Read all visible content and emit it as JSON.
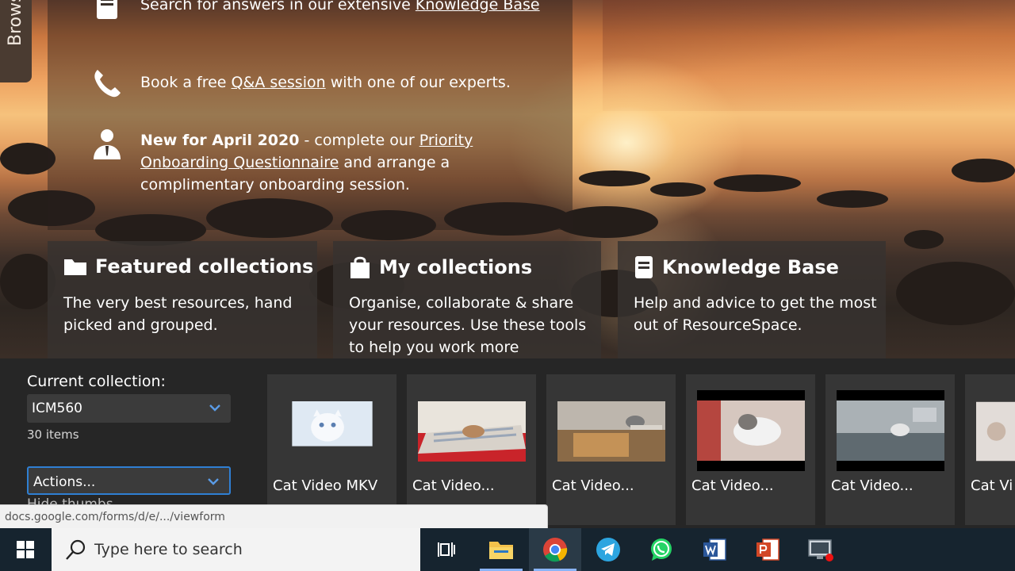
{
  "browse_tab": {
    "label": "Browse"
  },
  "welcome": {
    "knowledge_row": {
      "text": "Search for answers in our extensive ",
      "link": "Knowledge Base"
    },
    "qa_row": {
      "pre": "Book a free ",
      "link": "Q&A session",
      "post": " with one of our experts."
    },
    "onboarding_row": {
      "bold": "New for April 2020",
      "pre": " - complete our ",
      "link": "Priority Onboarding Questionnaire",
      "post": " and arrange a complimentary onboarding session."
    }
  },
  "panels": [
    {
      "title": "Featured collections",
      "body": "The very best resources, hand picked and grouped.",
      "icon": "folder-icon"
    },
    {
      "title": "My collections",
      "body": "Organise, collaborate & share your resources. Use these tools to help you work more",
      "icon": "shopping-bag-icon"
    },
    {
      "title": "Knowledge Base",
      "body": "Help and advice to get the most out of ResourceSpace.",
      "icon": "book-icon"
    }
  ],
  "collection": {
    "current_label": "Current collection:",
    "selected": "ICM560",
    "items_count": "30 items",
    "actions": "Actions...",
    "hidden_text": "Hide thumbs"
  },
  "thumbnails": [
    {
      "caption": "Cat Video MKV"
    },
    {
      "caption": "Cat Video..."
    },
    {
      "caption": "Cat Video..."
    },
    {
      "caption": "Cat Video..."
    },
    {
      "caption": "Cat Video..."
    },
    {
      "caption": "Cat Vi"
    }
  ],
  "status_url": "docs.google.com/forms/d/e/.../viewform",
  "taskbar": {
    "search_placeholder": "Type here to search",
    "apps": [
      "task-view",
      "file-explorer",
      "chrome",
      "telegram",
      "whatsapp",
      "word",
      "powerpoint",
      "remote-desktop"
    ]
  },
  "colors": {
    "accent_blue": "#2f7fd3",
    "taskbar": "#16242f",
    "panel": "#373230"
  }
}
